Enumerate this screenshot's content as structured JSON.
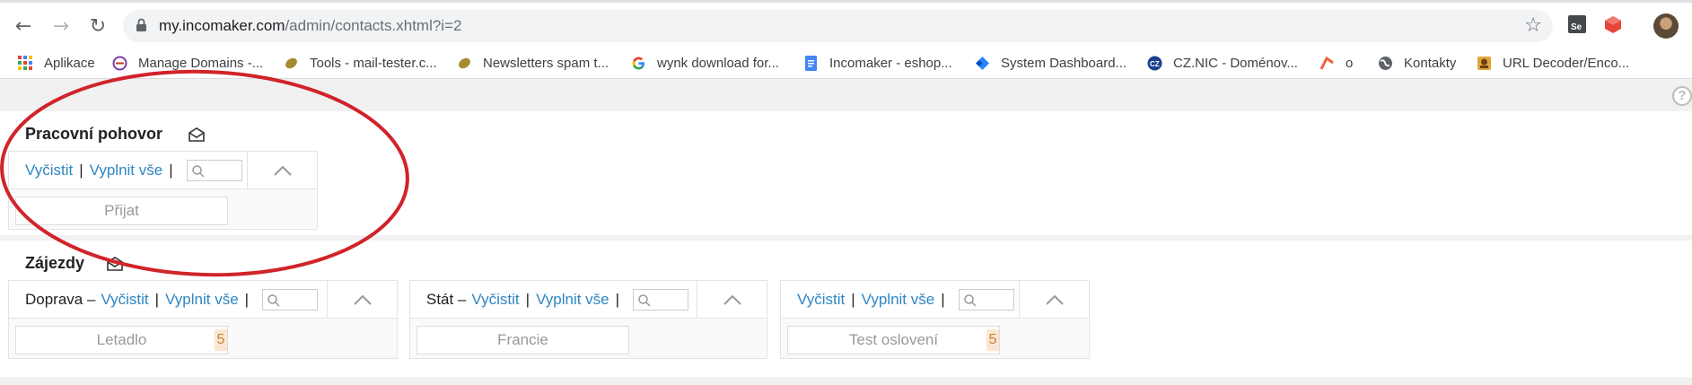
{
  "browser": {
    "url_host": "my.incomaker.com",
    "url_path": "/admin/contacts.xhtml?i=2",
    "bookmarks": [
      {
        "label": "Aplikace",
        "icon": "apps-grid-icon"
      },
      {
        "label": "Manage Domains -...",
        "icon": "domains-icon"
      },
      {
        "label": "Tools - mail-tester.c...",
        "icon": "leaf-icon"
      },
      {
        "label": "Newsletters spam t...",
        "icon": "leaf-icon"
      },
      {
        "label": "wynk download for...",
        "icon": "google-icon"
      },
      {
        "label": "Incomaker - eshop...",
        "icon": "docs-icon"
      },
      {
        "label": "System Dashboard...",
        "icon": "jira-icon"
      },
      {
        "label": "CZ.NIC - Doménov...",
        "icon": "cznic-icon"
      },
      {
        "label": "o",
        "icon": "bookmark-arrow-icon"
      },
      {
        "label": "Kontakty",
        "icon": "globe-icon"
      },
      {
        "label": "URL Decoder/Enco...",
        "icon": "url-decoder-icon"
      }
    ]
  },
  "help_label": "?",
  "sections": [
    {
      "title": "Pracovní pohovor",
      "filters": [
        {
          "label": "",
          "clear": "Vyčistit",
          "fill": "Vyplnit vše",
          "separator": "|",
          "value": "Přijat",
          "count": ""
        }
      ]
    },
    {
      "title": "Zájezdy",
      "filters": [
        {
          "label": "Doprava –",
          "clear": "Vyčistit",
          "fill": "Vyplnit vše",
          "separator": "|",
          "value": "Letadlo",
          "count": "5"
        },
        {
          "label": "Stát –",
          "clear": "Vyčistit",
          "fill": "Vyplnit vše",
          "separator": "|",
          "value": "Francie",
          "count": ""
        },
        {
          "label": "",
          "clear": "Vyčistit",
          "fill": "Vyplnit vše",
          "separator": "|",
          "value": "Test oslovení",
          "count": "5"
        }
      ]
    }
  ],
  "colors": {
    "link": "#2e86c1",
    "annotation": "#d1232a",
    "count_bg": "#fbe6d0"
  }
}
